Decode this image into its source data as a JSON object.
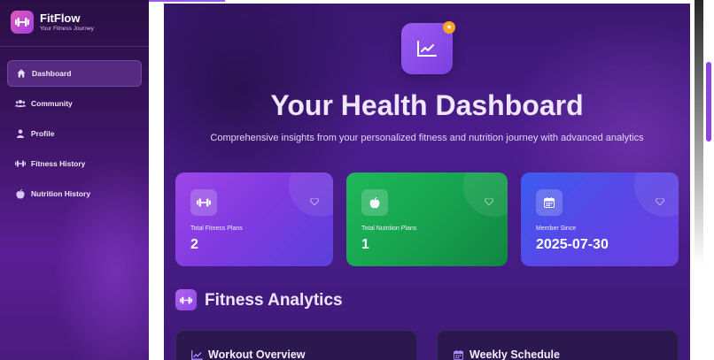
{
  "brand": {
    "name": "FitFlow",
    "tagline": "Your Fitness Journey",
    "logo_icon": "dumbbell-icon"
  },
  "sidebar": {
    "items": [
      {
        "label": "Dashboard",
        "icon": "home-icon",
        "active": true
      },
      {
        "label": "Community",
        "icon": "users-icon",
        "active": false
      },
      {
        "label": "Profile",
        "icon": "user-icon",
        "active": false
      },
      {
        "label": "Fitness History",
        "icon": "dumbbell-icon",
        "active": false
      },
      {
        "label": "Nutrition History",
        "icon": "apple-icon",
        "active": false
      }
    ]
  },
  "hero": {
    "icon": "chart-line-icon",
    "badge_icon": "star-icon",
    "title": "Your Health Dashboard",
    "subtitle": "Comprehensive insights from your personalized fitness and nutrition journey with advanced analytics"
  },
  "stats": [
    {
      "label": "Total Fitness Plans",
      "value": "2",
      "icon": "dumbbell-icon"
    },
    {
      "label": "Total Nutrition Plans",
      "value": "1",
      "icon": "apple-icon"
    },
    {
      "label": "Member Since",
      "value": "2025-07-30",
      "icon": "calendar-icon"
    }
  ],
  "section": {
    "title": "Fitness Analytics",
    "icon": "dumbbell-icon"
  },
  "panels": [
    {
      "title": "Workout Overview",
      "icon": "chart-line-icon"
    },
    {
      "title": "Weekly Schedule",
      "icon": "calendar-icon"
    }
  ],
  "colors": {
    "sidebar": "#3b1462",
    "main": "#4c1d8f",
    "fitness_card": "#9d46e8",
    "nutrition_card": "#1fb85a",
    "member_card": "#3c5cf0",
    "accent": "#9b59e8",
    "badge": "#f6a623"
  }
}
